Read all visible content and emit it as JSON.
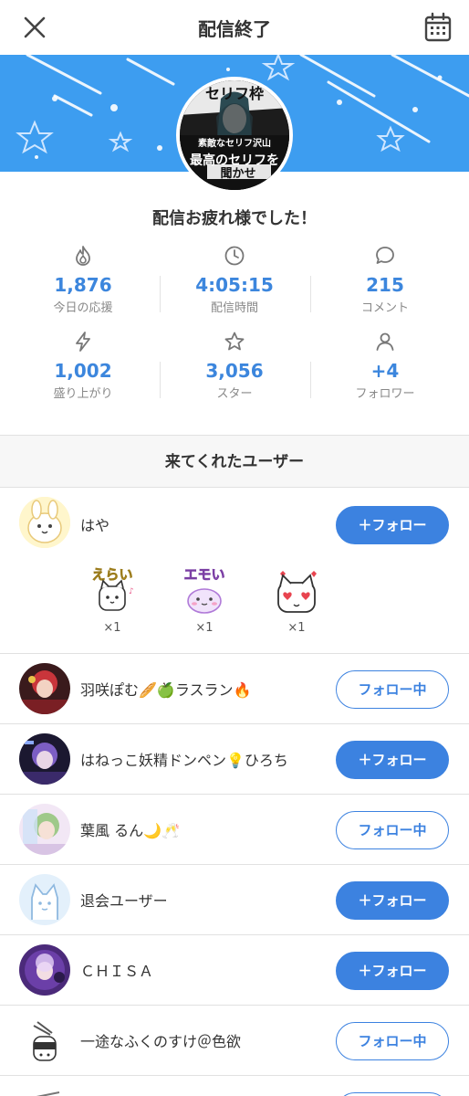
{
  "header": {
    "title": "配信終了",
    "close_icon": "close-icon",
    "calendar_icon": "calendar-icon"
  },
  "banner": {
    "color": "#3d9df0",
    "avatar_text_top": "セリフ枠",
    "avatar_text_mid": "素敵なセリフ沢山",
    "avatar_text_bottom": "最高のセリフを",
    "avatar_text_small": "聞かせ"
  },
  "message": "配信お疲れ様でした！",
  "stats": [
    {
      "icon": "flame-icon",
      "value": "1,876",
      "label": "今日の応援"
    },
    {
      "icon": "clock-icon",
      "value": "4:05:15",
      "label": "配信時間"
    },
    {
      "icon": "comment-icon",
      "value": "215",
      "label": "コメント"
    },
    {
      "icon": "lightning-icon",
      "value": "1,002",
      "label": "盛り上がり"
    },
    {
      "icon": "star-icon",
      "value": "3,056",
      "label": "スター"
    },
    {
      "icon": "person-icon",
      "value": "+4",
      "label": "フォロワー"
    }
  ],
  "section_title": "来てくれたユーザー",
  "first_user": {
    "name": "はや",
    "button": "＋フォロー",
    "stickers": [
      {
        "text": "えらい",
        "count": "×1"
      },
      {
        "text": "エモい",
        "count": "×1"
      },
      {
        "text": "",
        "count": "×1"
      }
    ]
  },
  "users": [
    {
      "name": "羽咲ぽむ🥖🍏ラスラン🔥",
      "button": "フォロー中",
      "state": "following"
    },
    {
      "name": "はねっこ妖精ドンペン💡ひろち",
      "button": "＋フォロー",
      "state": "follow"
    },
    {
      "name": "葉風 るん🌙🥂",
      "button": "フォロー中",
      "state": "following"
    },
    {
      "name": "退会ユーザー",
      "button": "＋フォロー",
      "state": "follow"
    },
    {
      "name": "ＣＨＩＳＡ",
      "button": "＋フォロー",
      "state": "follow"
    },
    {
      "name": "一途なふくのすけ＠色欲",
      "button": "フォロー中",
      "state": "following"
    }
  ],
  "colors": {
    "accent": "#3c82e0",
    "stat_value": "#3c86dd"
  }
}
